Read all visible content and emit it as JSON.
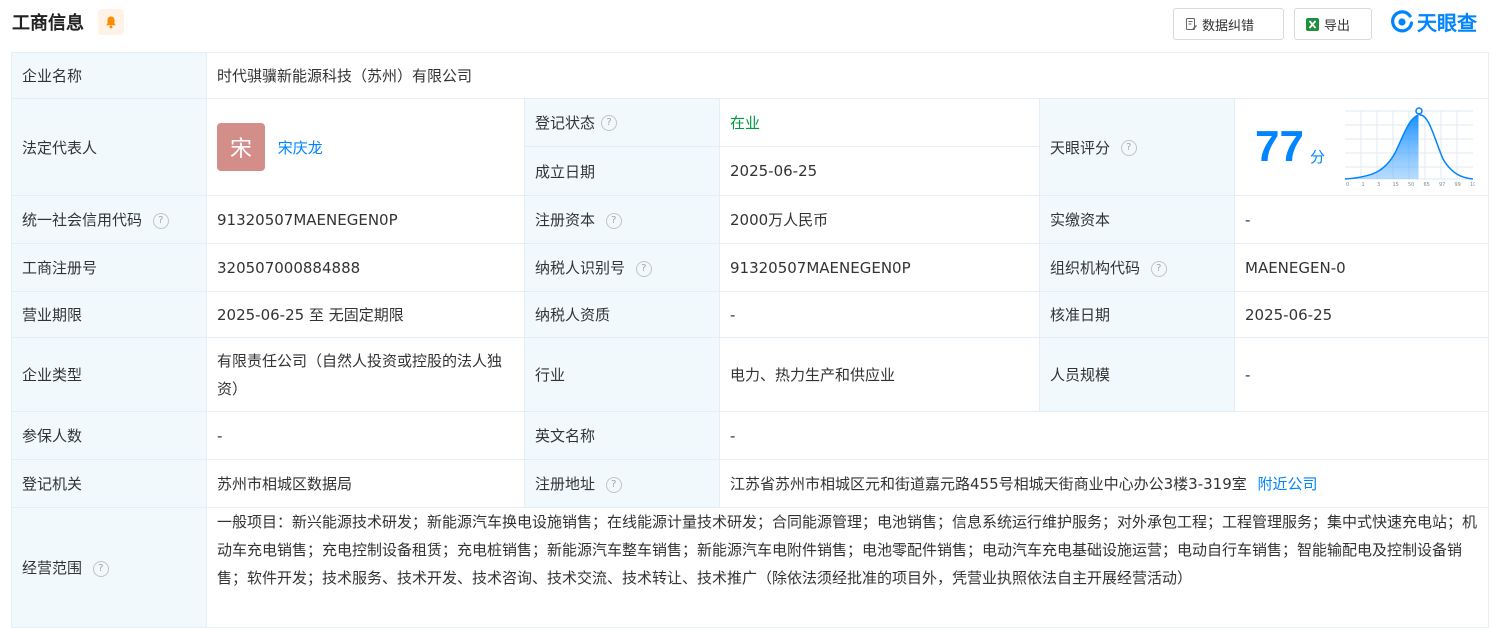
{
  "header": {
    "title": "工商信息",
    "error_button": "数据纠错",
    "export_button": "导出",
    "brand": "天眼查"
  },
  "labels": {
    "company_name": "企业名称",
    "legal_rep": "法定代表人",
    "reg_status": "登记状态",
    "found_date": "成立日期",
    "tianyan_score": "天眼评分",
    "credit_code": "统一社会信用代码",
    "reg_capital": "注册资本",
    "paid_capital": "实缴资本",
    "reg_number": "工商注册号",
    "taxpayer_id": "纳税人识别号",
    "org_code": "组织机构代码",
    "business_term": "营业期限",
    "taxpayer_qual": "纳税人资质",
    "approval_date": "核准日期",
    "company_type": "企业类型",
    "industry": "行业",
    "staff_size": "人员规模",
    "insured": "参保人数",
    "english_name": "英文名称",
    "reg_authority": "登记机关",
    "reg_address": "注册地址",
    "business_scope": "经营范围"
  },
  "values": {
    "company_name": "时代骐骥新能源科技（苏州）有限公司",
    "legal_rep_avatar": "宋",
    "legal_rep_name": "宋庆龙",
    "reg_status": "在业",
    "found_date": "2025-06-25",
    "score": "77",
    "score_unit": "分",
    "credit_code": "91320507MAENEGEN0P",
    "reg_capital": "2000万人民币",
    "paid_capital": "-",
    "reg_number": "320507000884888",
    "taxpayer_id": "91320507MAENEGEN0P",
    "org_code": "MAENEGEN-0",
    "business_term": "2025-06-25 至 无固定期限",
    "taxpayer_qual": "-",
    "approval_date": "2025-06-25",
    "company_type": "有限责任公司（自然人投资或控股的法人独资）",
    "industry": "电力、热力生产和供应业",
    "staff_size": "-",
    "insured": "-",
    "english_name": "-",
    "reg_authority": "苏州市相城区数据局",
    "reg_address": "江苏省苏州市相城区元和街道嘉元路455号相城天街商业中心办公3楼3-319室",
    "nearby_link": "附近公司",
    "business_scope": "一般项目：新兴能源技术研发；新能源汽车换电设施销售；在线能源计量技术研发；合同能源管理；电池销售；信息系统运行维护服务；对外承包工程；工程管理服务；集中式快速充电站；机动车充电销售；充电控制设备租赁；充电桩销售；新能源汽车整车销售；新能源汽车电附件销售；电池零配件销售；电动汽车充电基础设施运营；电动自行车销售；智能输配电及控制设备销售；软件开发；技术服务、技术开发、技术咨询、技术交流、技术转让、技术推广（除依法须经批准的项目外，凭营业执照依法自主开展经营活动）"
  },
  "score_chart": {
    "x_ticks": [
      "0",
      "1",
      "3",
      "15",
      "50",
      "65",
      "97",
      "99",
      "100"
    ],
    "highlight_value": 77
  },
  "colors": {
    "accent": "#0084ff",
    "label_bg": "#f2f9fc",
    "status_green": "#009944",
    "avatar_bg": "#d48e89"
  }
}
